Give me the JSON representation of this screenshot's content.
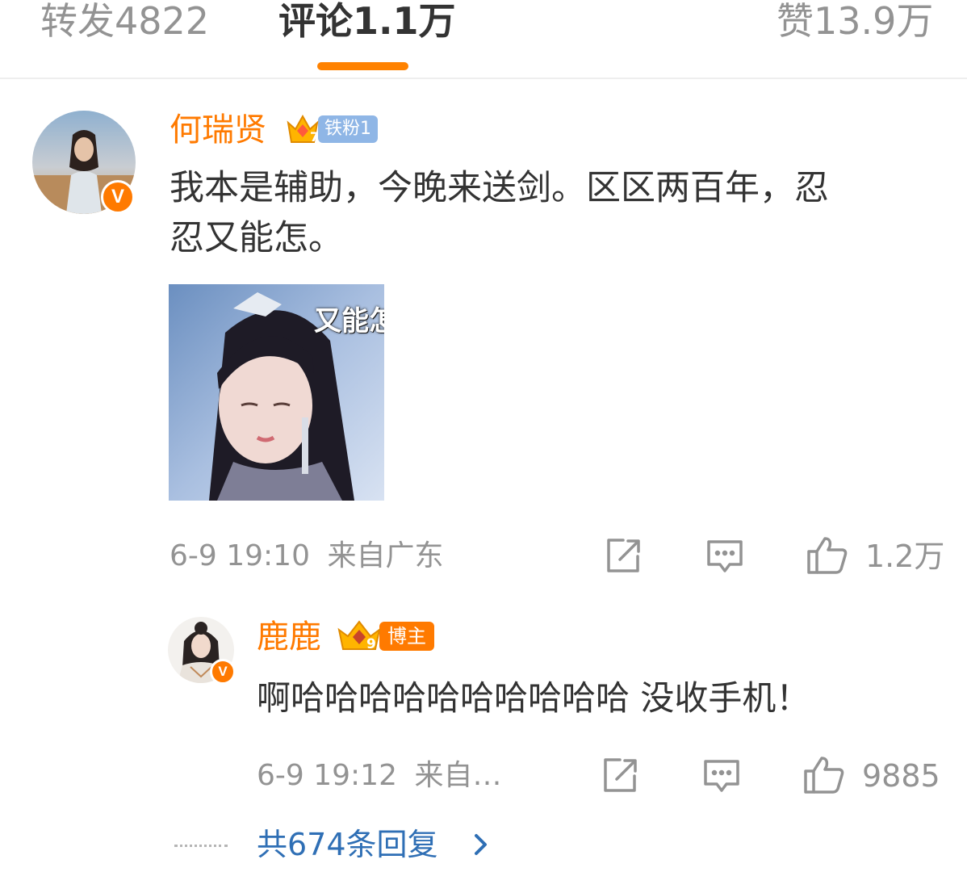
{
  "tabs": [
    {
      "label": "转发",
      "count": "4822"
    },
    {
      "label": "评论",
      "count": "1.1万"
    },
    {
      "label": "赞",
      "count": "13.9万"
    }
  ],
  "comment": {
    "username": "何瑞贤",
    "badge": {
      "level": "7",
      "label": "铁粉1"
    },
    "text_line1": "我本是辅助，今晚来送剑。区区两百年，忍",
    "text_line2": "忍又能怎。",
    "image_caption": "又能怎",
    "timestamp": "6-9 19:10",
    "location": "来自广东",
    "likes": "1.2万"
  },
  "reply": {
    "username": "鹿鹿",
    "badge": {
      "level": "9",
      "label": "博主"
    },
    "text": "啊哈哈哈哈哈哈哈哈哈哈 没收手机！",
    "timestamp": "6-9 19:12",
    "location": "来自…",
    "likes": "9885"
  },
  "more_replies": "共674条回复",
  "icons": [
    "repost-icon",
    "comment-icon",
    "like-icon",
    "chevron-right-icon",
    "verified-v-icon",
    "crown-icon"
  ],
  "colors": {
    "accent": "#ff8200",
    "username": "#ff7a00",
    "link": "#2f6fb5",
    "muted": "#939393",
    "text": "#333333"
  }
}
